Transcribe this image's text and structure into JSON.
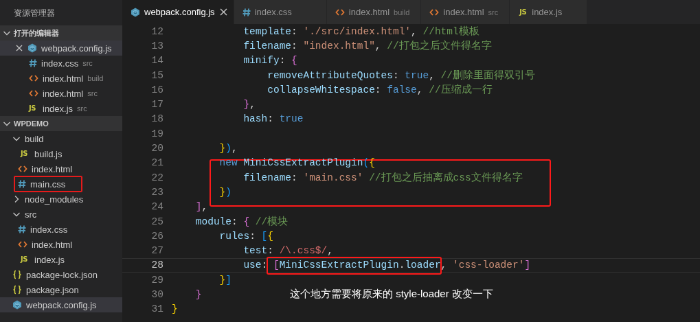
{
  "sidebar": {
    "title": "资源管理器",
    "sections": [
      {
        "label": "打开的编辑器",
        "expanded": true,
        "kind": "editors",
        "items": [
          {
            "name": "webpack.config.js",
            "kind": "webpack",
            "selected": true
          },
          {
            "name": "index.css",
            "kind": "css",
            "hint": "src",
            "selected": false
          },
          {
            "name": "index.html",
            "kind": "html",
            "hint": "build",
            "selected": false
          },
          {
            "name": "index.html",
            "kind": "html",
            "hint": "src",
            "selected": false
          },
          {
            "name": "index.js",
            "kind": "js",
            "badge": "JS",
            "hint": "src",
            "selected": false
          }
        ]
      },
      {
        "label": "WPDEMO",
        "expanded": true,
        "kind": "tree",
        "items": [
          {
            "name": "build",
            "kind": "folder",
            "expanded": true,
            "selected": false,
            "children": [
              {
                "name": "build.js",
                "kind": "js",
                "badge": "JS",
                "selected": false
              },
              {
                "name": "index.html",
                "kind": "html",
                "selected": false
              },
              {
                "name": "main.css",
                "kind": "css",
                "selected": false,
                "boxed": true
              }
            ]
          },
          {
            "name": "node_modules",
            "kind": "folder",
            "expanded": false,
            "selected": false
          },
          {
            "name": "src",
            "kind": "folder",
            "expanded": true,
            "selected": false,
            "children": [
              {
                "name": "index.css",
                "kind": "css",
                "selected": false
              },
              {
                "name": "index.html",
                "kind": "html",
                "selected": false
              },
              {
                "name": "index.js",
                "kind": "js",
                "badge": "JS",
                "selected": false
              }
            ]
          },
          {
            "name": "package-lock.json",
            "kind": "json",
            "selected": false
          },
          {
            "name": "package.json",
            "kind": "json",
            "selected": false
          },
          {
            "name": "webpack.config.js",
            "kind": "webpack",
            "selected": true
          }
        ]
      }
    ]
  },
  "tabs": [
    {
      "label": "webpack.config.js",
      "kind": "webpack",
      "selected": true
    },
    {
      "label": "index.css",
      "kind": "css",
      "selected": false
    },
    {
      "label": "index.html",
      "kind": "html",
      "hint": "build",
      "selected": false
    },
    {
      "label": "index.html",
      "kind": "html",
      "hint": "src",
      "selected": false
    },
    {
      "label": "index.js",
      "kind": "js",
      "badge": "JS",
      "selected": false
    }
  ],
  "editor": {
    "lines": [
      {
        "number": "12",
        "tokens": [
          {
            "kind": "prop",
            "text": "            template"
          },
          {
            "kind": "punct",
            "text": ": "
          },
          {
            "kind": "str",
            "text": "'./src/index.html'"
          },
          {
            "kind": "punct",
            "text": ", "
          },
          {
            "kind": "comment",
            "text": "//html模板"
          }
        ]
      },
      {
        "number": "13",
        "tokens": [
          {
            "kind": "prop",
            "text": "            filename"
          },
          {
            "kind": "punct",
            "text": ": "
          },
          {
            "kind": "str",
            "text": "\"index.html\""
          },
          {
            "kind": "punct",
            "text": ", "
          },
          {
            "kind": "comment",
            "text": "//打包之后文件得名字"
          }
        ]
      },
      {
        "number": "14",
        "tokens": [
          {
            "kind": "prop",
            "text": "            minify"
          },
          {
            "kind": "punct",
            "text": ": "
          },
          {
            "kind": "b2",
            "text": "{"
          }
        ]
      },
      {
        "number": "15",
        "tokens": [
          {
            "kind": "prop",
            "text": "                removeAttributeQuotes"
          },
          {
            "kind": "punct",
            "text": ": "
          },
          {
            "kind": "kw",
            "text": "true"
          },
          {
            "kind": "punct",
            "text": ", "
          },
          {
            "kind": "comment",
            "text": "//删除里面得双引号"
          }
        ]
      },
      {
        "number": "16",
        "tokens": [
          {
            "kind": "prop",
            "text": "                collapseWhitespace"
          },
          {
            "kind": "punct",
            "text": ": "
          },
          {
            "kind": "kw",
            "text": "false"
          },
          {
            "kind": "punct",
            "text": ", "
          },
          {
            "kind": "comment",
            "text": "//压缩成一行"
          }
        ]
      },
      {
        "number": "17",
        "tokens": [
          {
            "kind": "b2",
            "text": "            }"
          },
          {
            "kind": "punct",
            "text": ","
          }
        ]
      },
      {
        "number": "18",
        "tokens": [
          {
            "kind": "prop",
            "text": "            hash"
          },
          {
            "kind": "punct",
            "text": ": "
          },
          {
            "kind": "kw",
            "text": "true"
          }
        ]
      },
      {
        "number": "19"
      },
      {
        "number": "20",
        "tokens": [
          {
            "kind": "b1",
            "text": "        }"
          },
          {
            "kind": "b3",
            "text": ")"
          },
          {
            "kind": "punct",
            "text": ","
          }
        ]
      },
      {
        "number": "21",
        "boxed": true,
        "tokens": [
          {
            "kind": "kw",
            "text": "        new "
          },
          {
            "kind": "prop",
            "text": "MiniCssExtractPlugin"
          },
          {
            "kind": "b3",
            "text": "("
          },
          {
            "kind": "b1",
            "text": "{"
          }
        ]
      },
      {
        "number": "22",
        "boxed": true,
        "tokens": [
          {
            "kind": "prop",
            "text": "            filename"
          },
          {
            "kind": "punct",
            "text": ": "
          },
          {
            "kind": "str",
            "text": "'main.css'"
          },
          {
            "kind": "comment",
            "text": " //打包之后抽离成css文件得名字"
          }
        ]
      },
      {
        "number": "23",
        "boxed": true,
        "tokens": [
          {
            "kind": "b1",
            "text": "        }"
          },
          {
            "kind": "b3",
            "text": ")"
          }
        ]
      },
      {
        "number": "24",
        "tokens": [
          {
            "kind": "b2",
            "text": "    ]"
          },
          {
            "kind": "punct",
            "text": ","
          }
        ]
      },
      {
        "number": "25",
        "tokens": [
          {
            "kind": "prop",
            "text": "    module"
          },
          {
            "kind": "punct",
            "text": ": "
          },
          {
            "kind": "b2",
            "text": "{"
          },
          {
            "kind": "comment",
            "text": " //模块"
          }
        ]
      },
      {
        "number": "26",
        "tokens": [
          {
            "kind": "prop",
            "text": "        rules"
          },
          {
            "kind": "punct",
            "text": ": "
          },
          {
            "kind": "b3",
            "text": "["
          },
          {
            "kind": "b1",
            "text": "{"
          }
        ]
      },
      {
        "number": "27",
        "tokens": [
          {
            "kind": "prop",
            "text": "            test"
          },
          {
            "kind": "punct",
            "text": ": "
          },
          {
            "kind": "regex",
            "text": "/\\.css$/"
          },
          {
            "kind": "punct",
            "text": ","
          }
        ]
      },
      {
        "number": "28",
        "current": true,
        "tokens": [
          {
            "kind": "prop",
            "text": "            use"
          },
          {
            "kind": "punct",
            "text": ": "
          },
          {
            "kind": "b2",
            "text": "[",
            "boxed": true
          },
          {
            "kind": "prop",
            "text": "MiniCssExtractPlugin",
            "boxed": true
          },
          {
            "kind": "punct",
            "text": ".",
            "boxed": true
          },
          {
            "kind": "prop",
            "text": "loader",
            "boxed": true
          },
          {
            "kind": "punct",
            "text": ", "
          },
          {
            "kind": "str",
            "text": "'css-loader'"
          },
          {
            "kind": "b2",
            "text": "]"
          }
        ]
      },
      {
        "number": "29",
        "tokens": [
          {
            "kind": "b1",
            "text": "        }"
          },
          {
            "kind": "b3",
            "text": "]"
          }
        ]
      },
      {
        "number": "30",
        "note": "这个地方需要将原来的 style-loader 改变一下",
        "tokens": [
          {
            "kind": "b2",
            "text": "    }"
          }
        ]
      },
      {
        "number": "31",
        "tokens": [
          {
            "kind": "b1",
            "text": "}"
          }
        ]
      }
    ]
  }
}
